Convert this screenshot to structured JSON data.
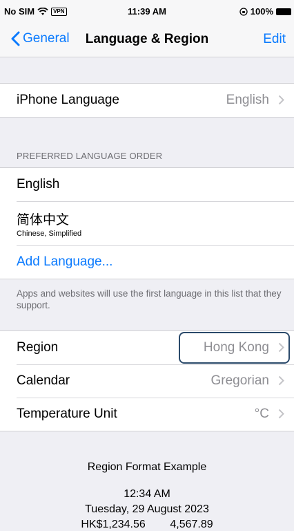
{
  "status": {
    "carrier": "No SIM",
    "vpn": "VPN",
    "time": "11:39 AM",
    "battery": "100%"
  },
  "nav": {
    "back_label": "General",
    "title": "Language & Region",
    "edit_label": "Edit"
  },
  "iphone_language": {
    "label": "iPhone Language",
    "value": "English"
  },
  "preferred": {
    "header": "PREFERRED LANGUAGE ORDER",
    "languages": [
      {
        "name": "English",
        "subtitle": ""
      },
      {
        "name": "简体中文",
        "subtitle": "Chinese, Simplified"
      }
    ],
    "add_label": "Add Language...",
    "footer": "Apps and websites will use the first language in this list that they support."
  },
  "settings": [
    {
      "label": "Region",
      "value": "Hong Kong"
    },
    {
      "label": "Calendar",
      "value": "Gregorian"
    },
    {
      "label": "Temperature Unit",
      "value": "°C"
    }
  ],
  "example": {
    "title": "Region Format Example",
    "time": "12:34 AM",
    "date": "Tuesday, 29 August 2023",
    "numbers": "HK$1,234.56        4,567.89"
  },
  "colors": {
    "accent": "#0a7afe",
    "background": "#efeff4",
    "highlight_border": "#2b4a6b"
  }
}
